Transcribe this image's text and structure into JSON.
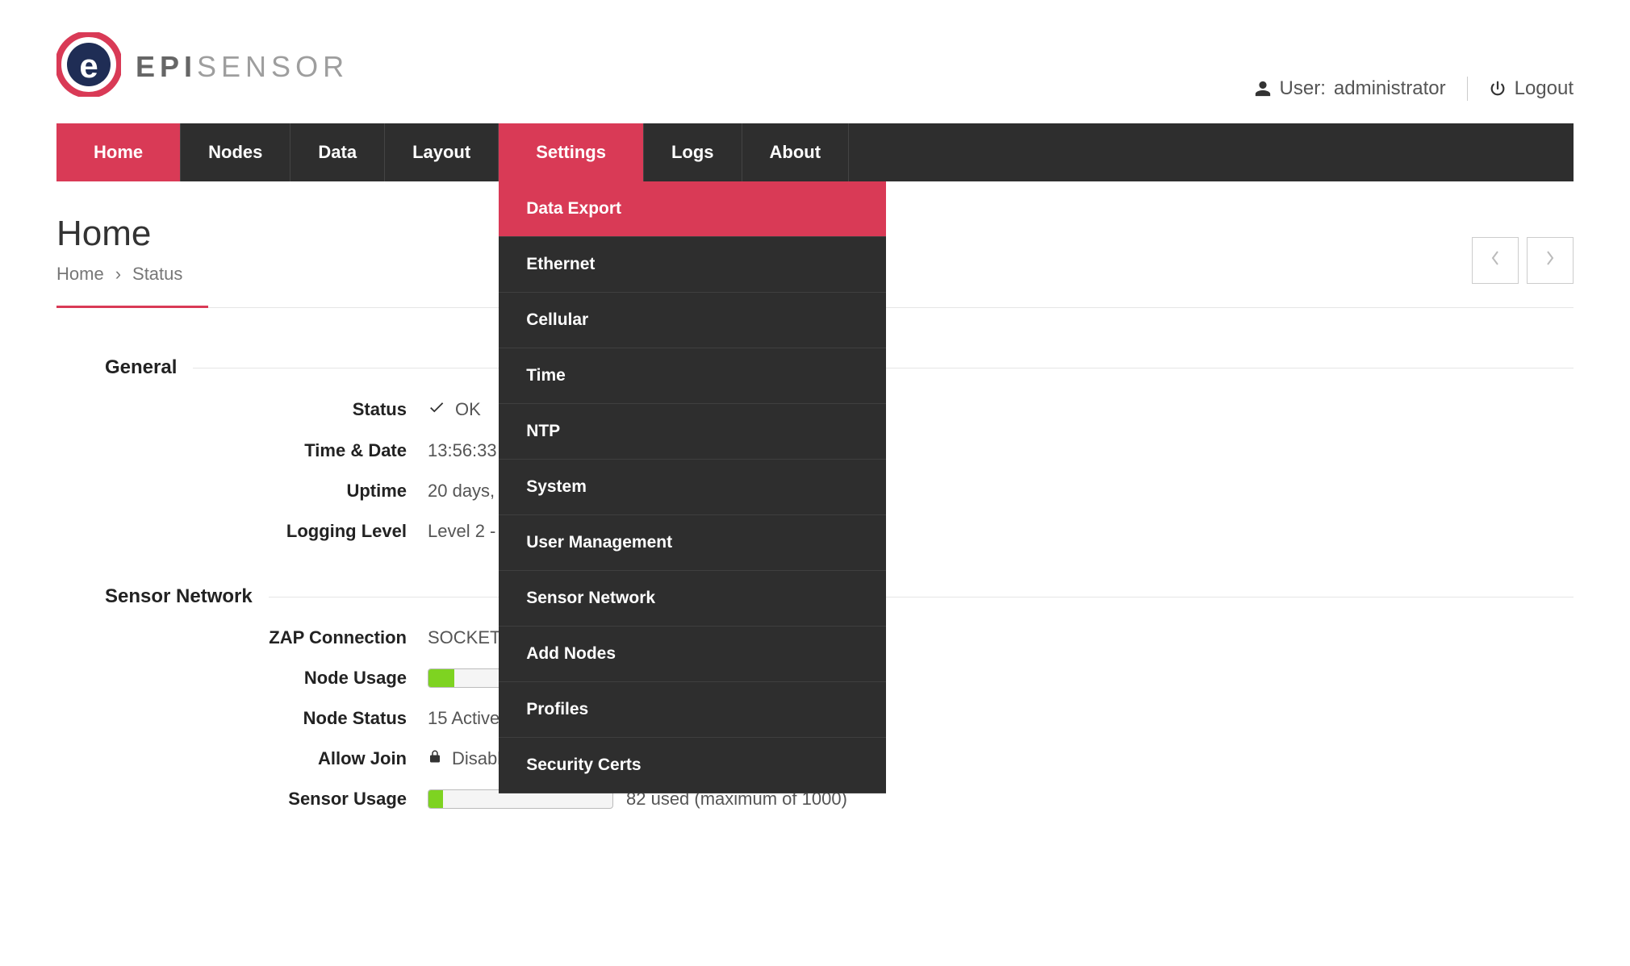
{
  "header": {
    "brand_a": "EPI",
    "brand_b": "SENSOR",
    "user_prefix": "User:",
    "user_name": "administrator",
    "logout": "Logout"
  },
  "nav": {
    "home": "Home",
    "nodes": "Nodes",
    "data": "Data",
    "layout": "Layout",
    "settings": "Settings",
    "logs": "Logs",
    "about": "About"
  },
  "settings_dropdown": [
    "Data Export",
    "Ethernet",
    "Cellular",
    "Time",
    "NTP",
    "System",
    "User Management",
    "Sensor Network",
    "Add Nodes",
    "Profiles",
    "Security Certs"
  ],
  "page": {
    "title": "Home",
    "bc1": "Home",
    "bc_sep": "›",
    "bc2": "Status"
  },
  "sections": {
    "general": {
      "title": "General",
      "status_label": "Status",
      "status_value": "OK",
      "time_label": "Time & Date",
      "time_value": "13:56:33",
      "uptime_label": "Uptime",
      "uptime_value": "20 days,",
      "log_label": "Logging Level",
      "log_value": "Level 2 -"
    },
    "sensor_network": {
      "title": "Sensor Network",
      "zap_label": "ZAP Connection",
      "zap_value": "SOCKET",
      "nodeusage_label": "Node Usage",
      "nodeusage_pct": 14,
      "nodestatus_label": "Node Status",
      "nodestatus_value": "15 Active",
      "allowjoin_label": "Allow Join",
      "allowjoin_value": "Disabled",
      "sensorusage_label": "Sensor Usage",
      "sensorusage_pct": 8,
      "sensorusage_caption": "82 used (maximum of 1000)"
    }
  },
  "colors": {
    "accent": "#d93a56",
    "nav_bg": "#2e2e2e",
    "progress_fill": "#7ed321"
  }
}
